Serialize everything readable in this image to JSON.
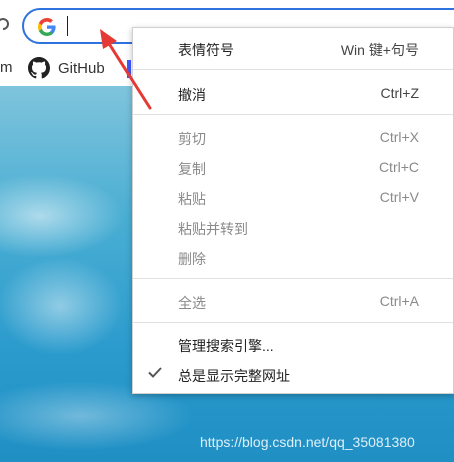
{
  "bookmarks_bar": {
    "partial_item": "m",
    "github": "GitHub"
  },
  "context_menu": {
    "emoji": {
      "label": "表情符号",
      "shortcut": "Win 键+句号"
    },
    "undo": {
      "label": "撤消",
      "shortcut": "Ctrl+Z"
    },
    "cut": {
      "label": "剪切",
      "shortcut": "Ctrl+X"
    },
    "copy": {
      "label": "复制",
      "shortcut": "Ctrl+C"
    },
    "paste": {
      "label": "粘贴",
      "shortcut": "Ctrl+V"
    },
    "paste_and_go": {
      "label": "粘贴并转到"
    },
    "delete": {
      "label": "删除"
    },
    "select_all": {
      "label": "全选",
      "shortcut": "Ctrl+A"
    },
    "manage_search": {
      "label": "管理搜索引擎..."
    },
    "always_show_full_url": {
      "label": "总是显示完整网址",
      "checked": true
    }
  },
  "watermark": "https://blog.csdn.net/qq_35081380",
  "colors": {
    "omnibox_border": "#2d72de",
    "arrow": "#e53935",
    "disabled_text": "#8a8a8a"
  }
}
